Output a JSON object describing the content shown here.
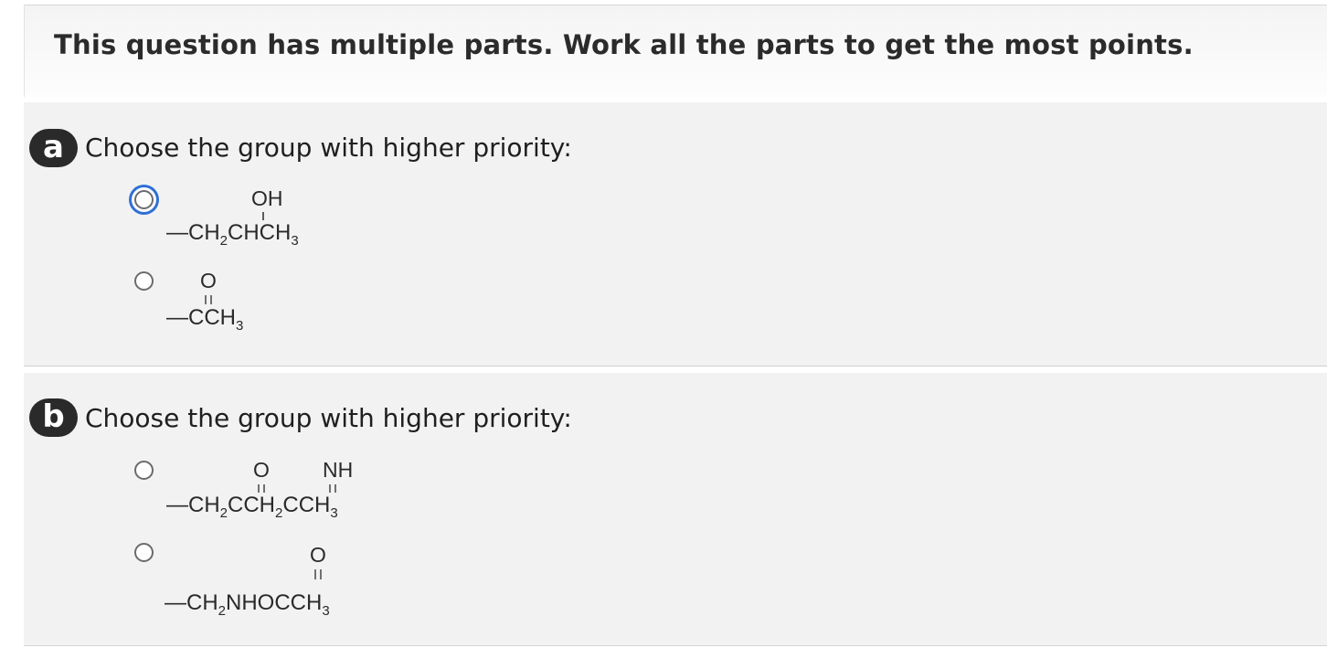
{
  "banner": {
    "text": "This question has multiple parts. Work all the parts to get the most points."
  },
  "parts": [
    {
      "badge": "a",
      "prompt": "Choose the group with higher priority:",
      "options": [
        {
          "selected": false,
          "focused": true,
          "structure": {
            "top_label": "OH",
            "main_text": "—CH",
            "sub1": "2",
            "main_text2": "CHCH",
            "sub2": "3"
          }
        },
        {
          "selected": false,
          "focused": false,
          "structure": {
            "top_label": "O",
            "main_text": "—CCH",
            "sub1": "3"
          }
        }
      ]
    },
    {
      "badge": "b",
      "prompt": "Choose the group with higher priority:",
      "options": [
        {
          "selected": false,
          "focused": false,
          "structure": {
            "top_label": "O",
            "top_label2": "NH",
            "main_text": "—CH",
            "sub1": "2",
            "main_text2": "CCH",
            "sub2": "2",
            "main_text3": "CCH",
            "sub3": "3"
          }
        },
        {
          "selected": false,
          "focused": false,
          "structure": {
            "top_label": "O",
            "main_text": "—CH",
            "sub1": "2",
            "main_text2": "NHOCCH",
            "sub2": "3"
          }
        }
      ]
    }
  ]
}
